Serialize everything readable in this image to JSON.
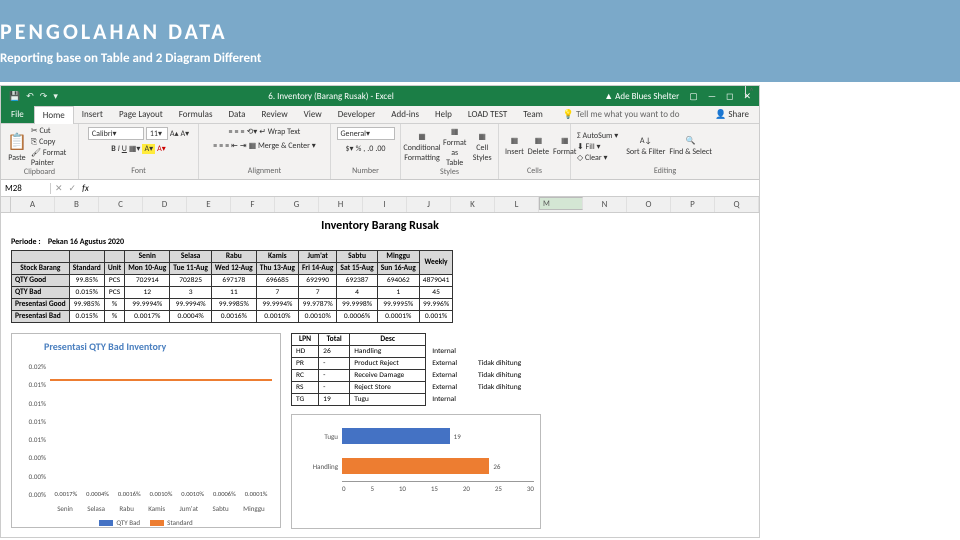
{
  "slide": {
    "title": "PENGOLAHAN DATA",
    "subtitle": "Reporting base on Table and 2 Diagram Different"
  },
  "titlebar": {
    "filename": "6. Inventory (Barang Rusak) - Excel",
    "user": "Ade Blues Shelter"
  },
  "tabs": {
    "file": "File",
    "items": [
      "Home",
      "Insert",
      "Page Layout",
      "Formulas",
      "Data",
      "Review",
      "View",
      "Developer",
      "Add-ins",
      "Help",
      "LOAD TEST",
      "Team"
    ],
    "tell": "Tell me what you want to do",
    "share": "Share"
  },
  "ribbon": {
    "clipboard": {
      "paste": "Paste",
      "cut": "Cut",
      "copy": "Copy",
      "painter": "Format Painter",
      "label": "Clipboard"
    },
    "font": {
      "name": "Calibri",
      "size": "11",
      "label": "Font"
    },
    "alignment": {
      "wrap": "Wrap Text",
      "merge": "Merge & Center",
      "label": "Alignment"
    },
    "number": {
      "format": "General",
      "label": "Number"
    },
    "styles": {
      "cf": "Conditional Formatting",
      "fat": "Format as Table",
      "cs": "Cell Styles",
      "label": "Styles"
    },
    "cells": {
      "ins": "Insert",
      "del": "Delete",
      "fmt": "Format",
      "label": "Cells"
    },
    "editing": {
      "sum": "AutoSum",
      "fill": "Fill",
      "clear": "Clear",
      "sort": "Sort & Filter",
      "find": "Find & Select",
      "label": "Editing"
    }
  },
  "namebox": "M28",
  "cols": [
    "A",
    "B",
    "C",
    "D",
    "E",
    "F",
    "G",
    "H",
    "I",
    "J",
    "K",
    "L",
    "M",
    "N",
    "O",
    "P",
    "Q"
  ],
  "sheet": {
    "title": "Inventory Barang Rusak",
    "periode_label": "Periode :",
    "periode_value": "Pekan 16 Agustus 2020",
    "headers_top": [
      "",
      "",
      "",
      "Senin",
      "Selasa",
      "Rabu",
      "Kamis",
      "Jum'at",
      "Sabtu",
      "Minggu",
      ""
    ],
    "headers": [
      "Stock Barang",
      "Standard",
      "Unit",
      "Mon 10-Aug",
      "Tue 11-Aug",
      "Wed 12-Aug",
      "Thu 13-Aug",
      "Fri 14-Aug",
      "Sat 15-Aug",
      "Sun 16-Aug",
      "Weekly"
    ],
    "rows": [
      [
        "QTY Good",
        "99.85%",
        "PCS",
        "702914",
        "702825",
        "697178",
        "696685",
        "692990",
        "692387",
        "694062",
        "4879041"
      ],
      [
        "QTY Bad",
        "0.015%",
        "PCS",
        "12",
        "3",
        "11",
        "7",
        "7",
        "4",
        "1",
        "45"
      ],
      [
        "Presentasi Good",
        "99.985%",
        "%",
        "99.9994%",
        "99.9994%",
        "99.9985%",
        "99.9994%",
        "99.9787%",
        "99.9998%",
        "99.9995%",
        "99.996%"
      ],
      [
        "Presentasi Bad",
        "0.015%",
        "%",
        "0.0017%",
        "0.0004%",
        "0.0016%",
        "0.0010%",
        "0.0010%",
        "0.0006%",
        "0.0001%",
        "0.001%"
      ]
    ]
  },
  "lpn": {
    "headers": [
      "LPN",
      "Total",
      "Desc",
      "",
      ""
    ],
    "rows": [
      [
        "HD",
        "26",
        "Handling",
        "Internal",
        ""
      ],
      [
        "PR",
        "-",
        "Product Reject",
        "External",
        "Tidak dihitung"
      ],
      [
        "RC",
        "-",
        "Receive Damage",
        "External",
        "Tidak dihitung"
      ],
      [
        "RS",
        "-",
        "Reject Store",
        "External",
        "Tidak dihitung"
      ],
      [
        "TG",
        "19",
        "Tugu",
        "Internal",
        ""
      ]
    ]
  },
  "chart_data": [
    {
      "type": "bar",
      "title": "Presentasi QTY Bad Inventory",
      "categories": [
        "Senin",
        "Selasa",
        "Rabu",
        "Kamis",
        "Jum'at",
        "Sabtu",
        "Minggu"
      ],
      "series": [
        {
          "name": "QTY Bad",
          "values": [
            0.0017,
            0.0004,
            0.0016,
            0.001,
            0.001,
            0.0006,
            0.0001
          ],
          "color": "#4472c4"
        },
        {
          "name": "Standard",
          "values": [
            0.015,
            0.015,
            0.015,
            0.015,
            0.015,
            0.015,
            0.015
          ],
          "color": "#ed7d31",
          "style": "line"
        }
      ],
      "ylim": [
        0,
        0.02
      ],
      "yticks": [
        "0.02%",
        "0.01%",
        "0.01%",
        "0.01%",
        "0.01%",
        "0.00%",
        "0.00%",
        "0.00%"
      ]
    },
    {
      "type": "bar",
      "orientation": "horizontal",
      "categories": [
        "Tugu",
        "Handling"
      ],
      "values": [
        19,
        26
      ],
      "colors": [
        "#4472c4",
        "#ed7d31"
      ],
      "xlim": [
        0,
        30
      ],
      "xticks": [
        0,
        5,
        10,
        15,
        20,
        25,
        30
      ]
    }
  ]
}
